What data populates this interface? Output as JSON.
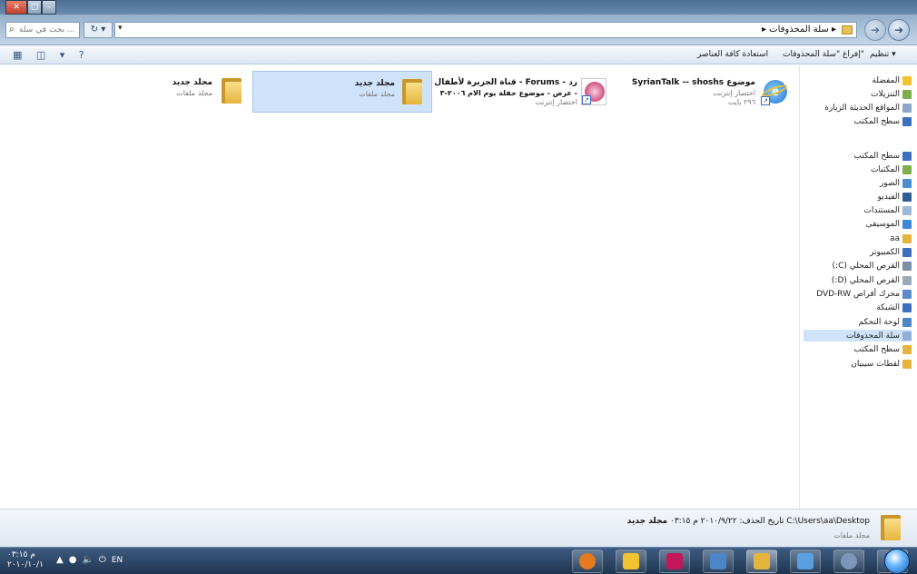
{
  "window": {
    "title_buttons": [
      "✕",
      "▢",
      "–"
    ]
  },
  "address": {
    "search_placeholder": "بحث في سلة ...",
    "refresh_label": "↻ ▾",
    "path": "▸ سلة المحذوفات ▸ "
  },
  "toolbar": {
    "organize": "تنظيم ▾",
    "empty_bin": "إفراغ \"سلة المحذوفات\"",
    "restore_all": "استعادة كافة العناصر"
  },
  "items": [
    {
      "name": "موضوع SyrianTalk -- shoshs",
      "line1": "اختصار إنترنت",
      "line2": "٢٩٦ بايت",
      "icon": "ie-shortcut-icon"
    },
    {
      "name": "رد - Forums - قناة الجزيرة لأطفال",
      "line1": "- عرض - موضوع حفلة يوم الام ٢٠٠٦-٣",
      "line2": "اختصار إنترنت",
      "icon": "pink-shortcut-icon"
    },
    {
      "name": "مجلد جديد",
      "line1": "مجلد ملفات",
      "icon": "folder-icon",
      "selected": true
    },
    {
      "name": "مجلد جديد",
      "line1": "مجلد ملفات",
      "icon": "folder-icon"
    }
  ],
  "navpane": [
    {
      "label": "المفضلة",
      "icon": "star-icon",
      "color": "#f2c230"
    },
    {
      "label": "التنزيلات",
      "icon": "downloads-icon",
      "color": "#7fae4c"
    },
    {
      "label": "المواقع الحديثة الزيارة",
      "icon": "recent-icon",
      "color": "#8fa7c7"
    },
    {
      "label": "سطح المكتب",
      "icon": "desktop-icon",
      "color": "#3c6fc0"
    },
    {
      "label": "سطح المكتب",
      "icon": "desktop-icon",
      "color": "#3c6fc0"
    },
    {
      "label": "المكتبات",
      "icon": "libraries-icon",
      "color": "#7fae4c"
    },
    {
      "label": "الصور",
      "icon": "pictures-icon",
      "color": "#4a8fd0"
    },
    {
      "label": "الفيديو",
      "icon": "videos-icon",
      "color": "#2f5d95"
    },
    {
      "label": "المستندات",
      "icon": "documents-icon",
      "color": "#9fb8d6"
    },
    {
      "label": "الموسيقى",
      "icon": "music-icon",
      "color": "#3f8ad8"
    },
    {
      "label": "aa",
      "icon": "user-folder-icon",
      "color": "#e5b43f"
    },
    {
      "label": "الكمبيوتر",
      "icon": "computer-icon",
      "color": "#3c6fc0"
    },
    {
      "label": "القرص المحلي (C:)",
      "icon": "drive-c-icon",
      "color": "#7b8fa6"
    },
    {
      "label": "القرص المحلي (D:)",
      "icon": "drive-d-icon",
      "color": "#9aa9ba"
    },
    {
      "label": "محرك أقراص DVD-RW",
      "icon": "dvd-icon",
      "color": "#5a8ccd"
    },
    {
      "label": "الشبكة",
      "icon": "network-icon",
      "color": "#3c6fc0"
    },
    {
      "label": "لوحة التحكم",
      "icon": "control-panel-icon",
      "color": "#4d86c8"
    },
    {
      "label": "سلة المحذوفات",
      "icon": "recycle-bin-icon",
      "color": "#8fb0d8",
      "selected": true
    },
    {
      "label": "سطح المكتب",
      "icon": "folder-icon",
      "color": "#e5b43f"
    },
    {
      "label": "لقطات سيبيان",
      "icon": "folder-icon",
      "color": "#e5b43f"
    }
  ],
  "details": {
    "name_bold": "مجلد جديد",
    "path": "C:\\Users\\aa\\Desktop",
    "date_label": "تاريخ الحذف: ٢٠١٠/٩/٢٢ م ٠٣:١٥",
    "type": "مجلد ملفات"
  },
  "taskbar": {
    "time": "م ٠٣:١٥",
    "date": "٢٠١٠/١٠/١",
    "lang": "EN",
    "apps": [
      {
        "icon": "firefox-icon",
        "color": "#e57b1c"
      },
      {
        "icon": "winamp-icon",
        "color": "#f2c230"
      },
      {
        "icon": "messenger-icon",
        "color": "#c2185b"
      },
      {
        "icon": "control-panel-icon",
        "color": "#4d86c8"
      },
      {
        "icon": "explorer-icon",
        "color": "#e5b43f"
      },
      {
        "icon": "notepad-icon",
        "color": "#5aa0e0"
      },
      {
        "icon": "user-icon",
        "color": "#7d95b8"
      },
      {
        "icon": "word-icon",
        "color": "#2d5ba8"
      }
    ]
  }
}
